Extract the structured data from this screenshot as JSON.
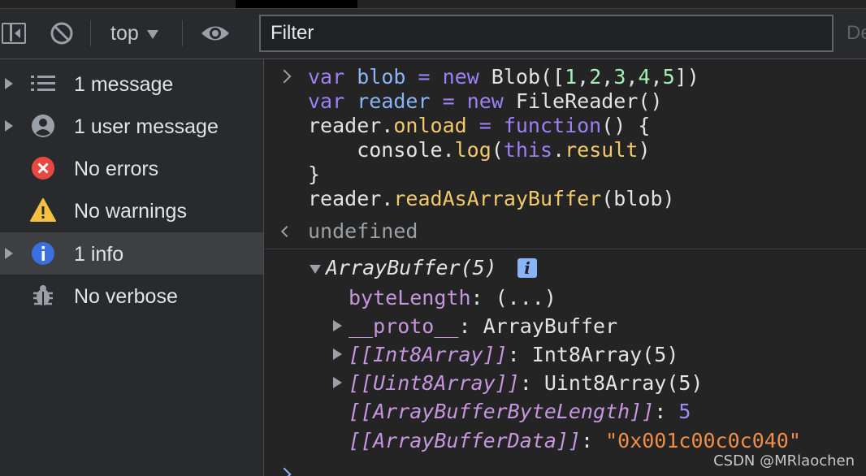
{
  "toolbar": {
    "context": "top",
    "filter_placeholder": "Filter",
    "levels_label": "De"
  },
  "sidebar": {
    "items": [
      {
        "label": "1 message",
        "icon": "list-icon",
        "expandable": true
      },
      {
        "label": "1 user message",
        "icon": "user-icon",
        "expandable": true
      },
      {
        "label": "No errors",
        "icon": "error-icon",
        "expandable": false
      },
      {
        "label": "No warnings",
        "icon": "warning-icon",
        "expandable": false
      },
      {
        "label": "1 info",
        "icon": "info-icon",
        "expandable": true,
        "selected": true
      },
      {
        "label": "No verbose",
        "icon": "bug-icon",
        "expandable": false
      }
    ]
  },
  "console": {
    "input": {
      "l1": {
        "kw1": "var",
        "v1": "blob",
        "eq": " = ",
        "kw2": "new",
        "rest1": " Blob([",
        "n1": "1",
        "c1": ",",
        "n2": "2",
        "c2": ",",
        "n3": "3",
        "c3": ",",
        "n4": "4",
        "c4": ",",
        "n5": "5",
        "rest2": "])"
      },
      "l2": {
        "kw1": "var",
        "v1": "reader",
        "eq": " = ",
        "kw2": "new",
        "rest": " FileReader()"
      },
      "l3": {
        "obj": "reader.",
        "prop": "onload",
        "eq": " = ",
        "kw": "function",
        "rest": "() {"
      },
      "l4": {
        "pre": "    console.",
        "fn": "log",
        "open": "(",
        "kw": "this",
        "dot": ".",
        "prop": "result",
        "close": ")"
      },
      "l5": "}",
      "l6": {
        "obj": "reader.",
        "fn": "readAsArrayBuffer",
        "rest": "(blob)"
      }
    },
    "result": "undefined",
    "log": {
      "header": "ArrayBuffer(5)",
      "info_badge": "i",
      "props": {
        "byteLength_key": "byteLength",
        "byteLength_val": ": (...)",
        "proto_key": "__proto__",
        "proto_val": ": ArrayBuffer",
        "int8_key": "[[Int8Array]]",
        "int8_val": ": Int8Array(5)",
        "uint8_key": "[[Uint8Array]]",
        "uint8_val": ": Uint8Array(5)",
        "bytelen_key": "[[ArrayBufferByteLength]]",
        "bytelen_sep": ": ",
        "bytelen_val": "5",
        "data_key": "[[ArrayBufferData]]",
        "data_sep": ": ",
        "data_val": "\"0x001c00c0c040\""
      }
    }
  },
  "watermark": "CSDN @MRlaochen",
  "colors": {
    "keyword": "#c792ea",
    "variable": "#8ab4f8",
    "number": "#a4f0b7",
    "function": "#f2c96a",
    "string": "#f08d49"
  }
}
